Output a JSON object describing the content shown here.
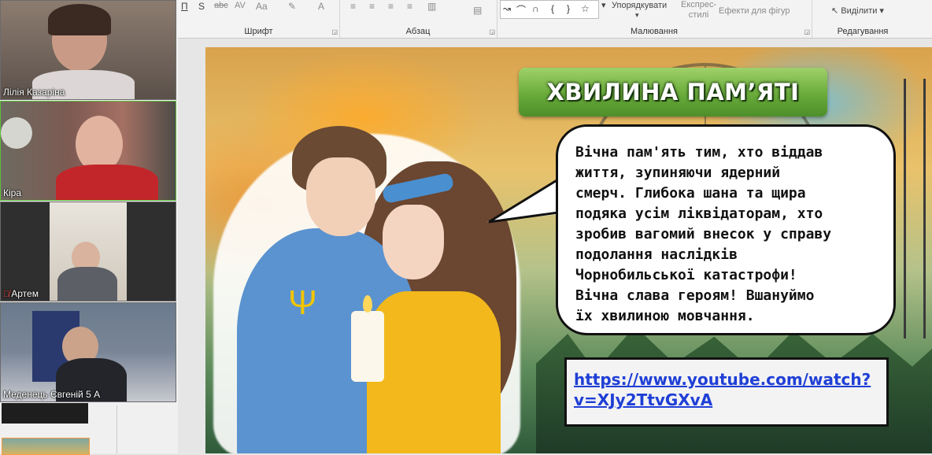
{
  "ribbon": {
    "groups": [
      {
        "label": "Шрифт"
      },
      {
        "label": "Абзац"
      },
      {
        "label": "Малювання"
      },
      {
        "label": "Редагування"
      }
    ],
    "font_tools": [
      "П",
      "S",
      "abc",
      "AV",
      "Aa",
      "A"
    ],
    "drawing": {
      "arrange_label": "Упорядкувати",
      "quick_styles_label": "Експрес-\nстилі",
      "shape_effects_label": "Ефекти для фігур"
    },
    "editing": {
      "select_label": "Виділити"
    }
  },
  "participants": [
    {
      "name": "Лілія Казаріна",
      "muted": false
    },
    {
      "name": "Кіра",
      "muted": false
    },
    {
      "name": "Артем",
      "muted": true
    },
    {
      "name": "Меденець Євгеній 5 А",
      "muted": false
    }
  ],
  "slide": {
    "title": "ХВИЛИНА ПАМ’ЯТІ",
    "bubble_text": "Вічна пам'ять тим, хто віддав\nжиття, зупиняючи ядерний\nсмерч. Глибока шана та щира\nподяка усім ліквідаторам, хто\nзробив вагомий внесок у справу\nподолання наслідків\nЧорнобильської катастрофи!\nВічна слава героям! Вшануймо\nїх хвилиною мовчання.",
    "link": "https://www.youtube.com/watch?v=XJy2TtvGXvA",
    "link_display": "https://www.youtube.com/watch?\nv=XJy2TtvGXvA"
  },
  "colors": {
    "banner_green": "#6aab3b",
    "link_blue": "#1f3fd6",
    "active_border": "#5fbf3c"
  },
  "icons": [
    "bold-icon",
    "strike-icon",
    "char-spacing-icon",
    "change-case-icon",
    "highlight-icon",
    "font-color-icon",
    "align-left-icon",
    "align-center-icon",
    "align-right-icon",
    "justify-icon",
    "columns-icon",
    "shapes-gallery-icon",
    "select-cursor-icon",
    "mic-muted-icon"
  ]
}
